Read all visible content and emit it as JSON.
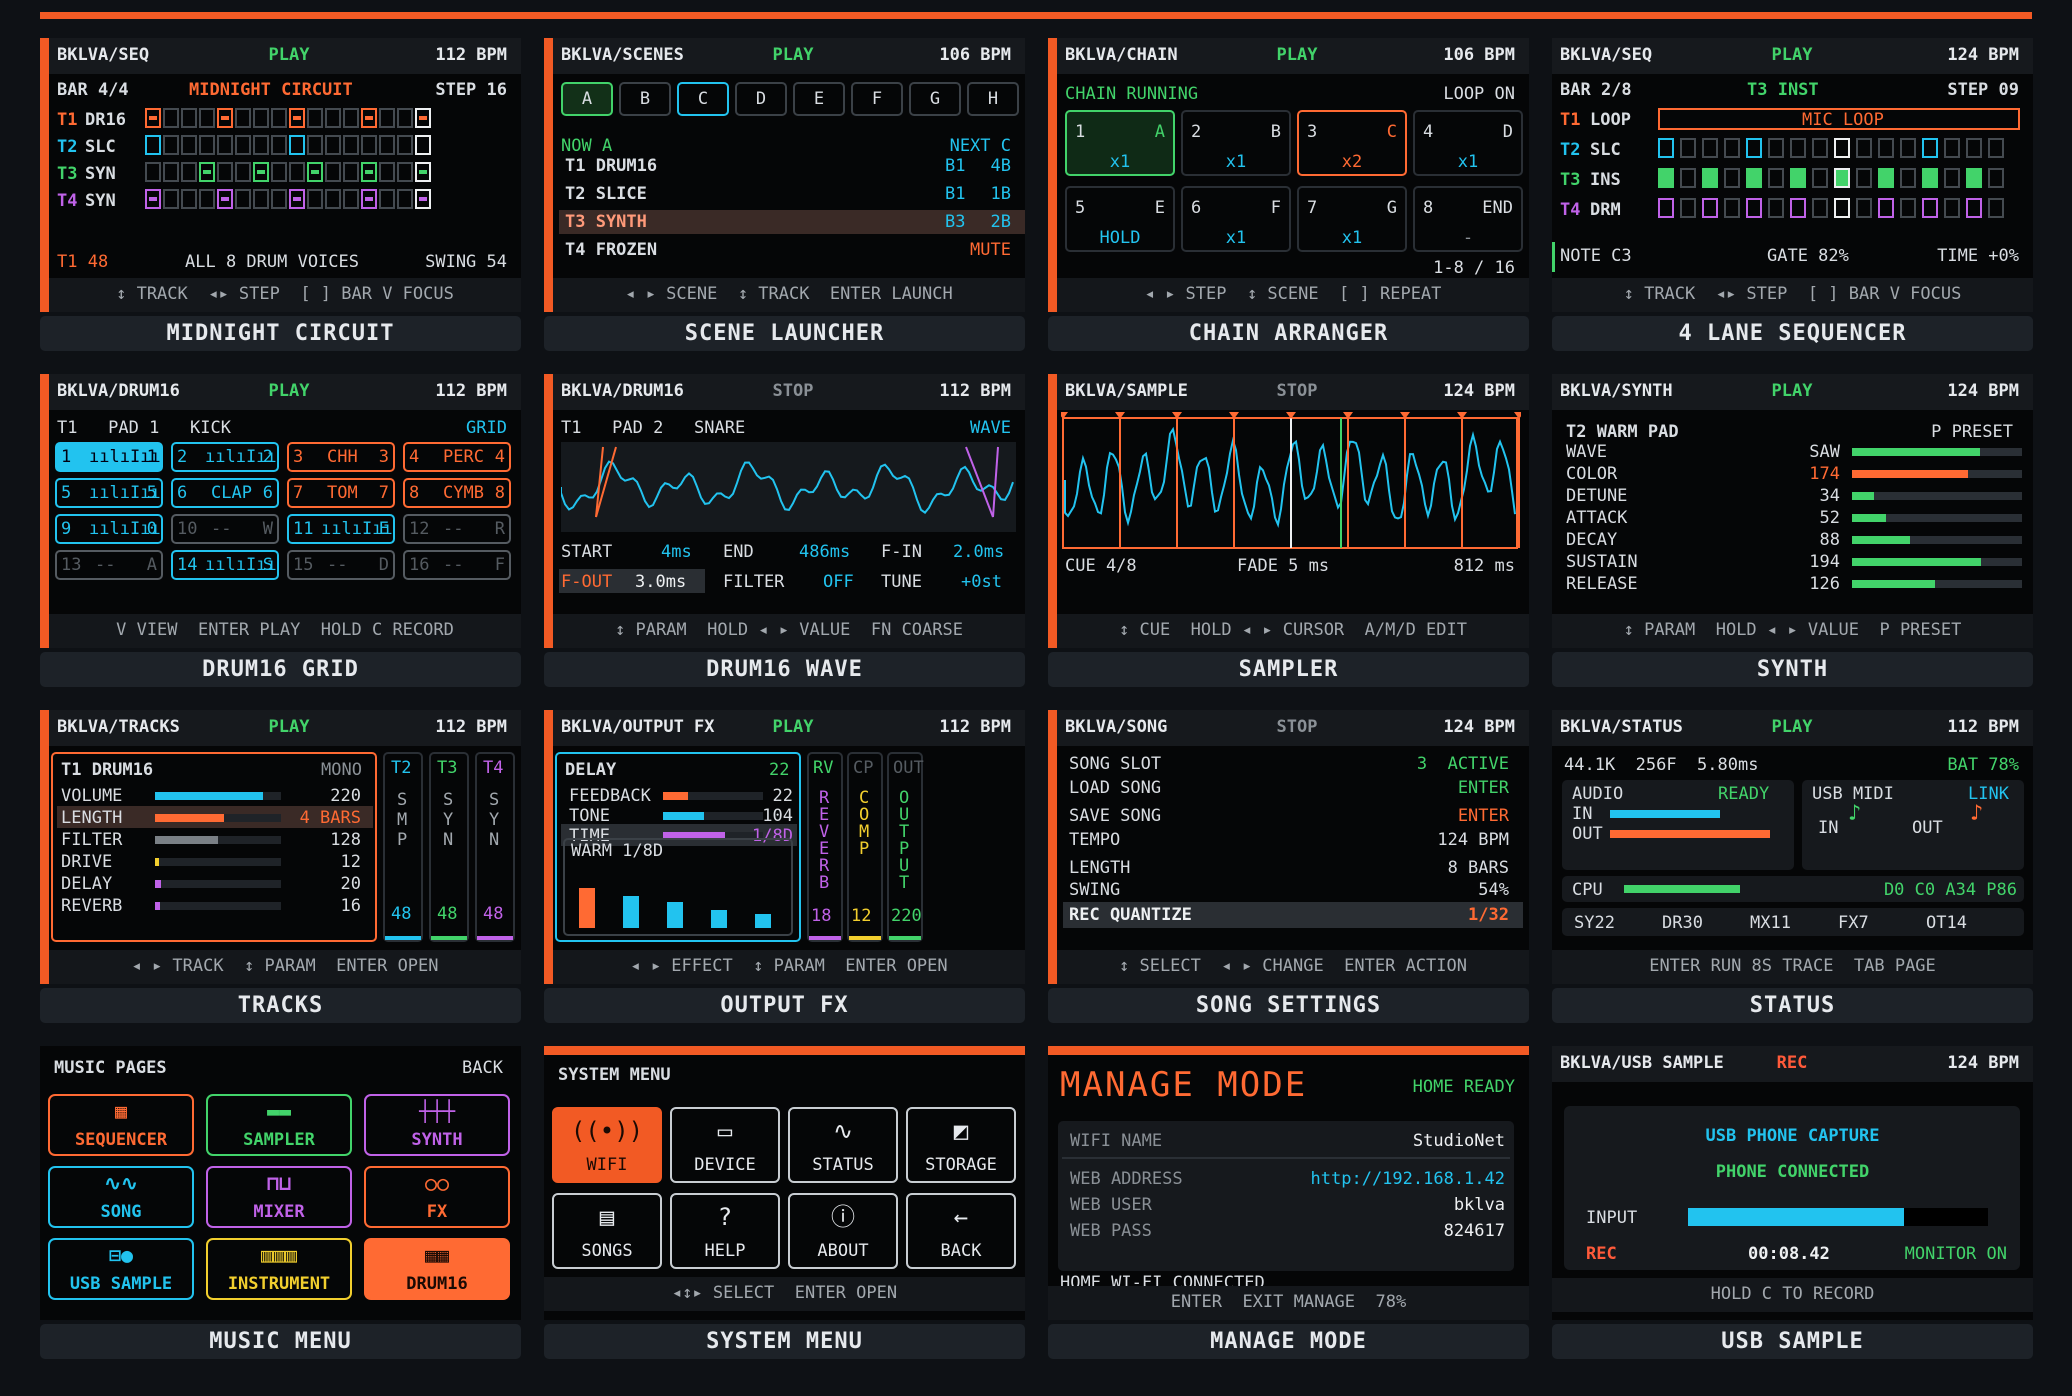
{
  "panels": {
    "p1": {
      "title": "BKLVA/SEQ",
      "state": "PLAY",
      "bpm": "112 BPM",
      "bar": "BAR 4/4",
      "name": "MIDNIGHT CIRCUIT",
      "step": "STEP 16",
      "rows": [
        {
          "num": "T1",
          "lbl": "DR16"
        },
        {
          "num": "T2",
          "lbl": "SLC"
        },
        {
          "num": "T3",
          "lbl": "SYN"
        },
        {
          "num": "T4",
          "lbl": "SYN"
        }
      ],
      "info_l": "T1 48",
      "info_m": "ALL 8 DRUM VOICES",
      "info_r": "SWING 54",
      "foot": "↕ TRACK  ◂▸ STEP  [ ] BAR V FOCUS",
      "caption": "MIDNIGHT CIRCUIT"
    },
    "p2": {
      "title": "BKLVA/SCENES",
      "state": "PLAY",
      "bpm": "106 BPM",
      "scenes": [
        "A",
        "B",
        "C",
        "D",
        "E",
        "F",
        "G",
        "H"
      ],
      "now": "NOW A",
      "next": "NEXT C",
      "rows": [
        {
          "t": "T1 DRUM16",
          "a": "B1",
          "b": "4B"
        },
        {
          "t": "T2 SLICE",
          "a": "B1",
          "b": "1B"
        },
        {
          "t": "T3 SYNTH",
          "a": "B3",
          "b": "2B"
        },
        {
          "t": "T4 FROZEN",
          "a": "",
          "b": "MUTE"
        }
      ],
      "foot": "◂ ▸ SCENE  ↕ TRACK  ENTER LAUNCH",
      "caption": "SCENE LAUNCHER"
    },
    "p3": {
      "title": "BKLVA/CHAIN",
      "state": "PLAY",
      "bpm": "106 BPM",
      "status": "CHAIN RUNNING",
      "loop": "LOOP ON",
      "slots": [
        {
          "n": "1",
          "s": "A",
          "x": "x1"
        },
        {
          "n": "2",
          "s": "B",
          "x": "x1"
        },
        {
          "n": "3",
          "s": "C",
          "x": "x2"
        },
        {
          "n": "4",
          "s": "D",
          "x": "x1"
        },
        {
          "n": "5",
          "s": "E",
          "x": "HOLD"
        },
        {
          "n": "6",
          "s": "F",
          "x": "x1"
        },
        {
          "n": "7",
          "s": "G",
          "x": "x1"
        },
        {
          "n": "8",
          "s": "END",
          "x": "-"
        }
      ],
      "page": "1-8 / 16",
      "foot": "◂ ▸ STEP  ↕ SCENE  [ ] REPEAT",
      "caption": "CHAIN ARRANGER"
    },
    "p4": {
      "title": "BKLVA/SEQ",
      "state": "PLAY",
      "bpm": "124 BPM",
      "bar": "BAR 2/8",
      "inst": "T3 INST",
      "step": "STEP 09",
      "rows": [
        {
          "num": "T1",
          "lbl": "LOOP"
        },
        {
          "num": "T2",
          "lbl": "SLC"
        },
        {
          "num": "T3",
          "lbl": "INS"
        },
        {
          "num": "T4",
          "lbl": "DRM"
        }
      ],
      "mic": "MIC LOOP",
      "note": "NOTE C3",
      "gate": "GATE 82%",
      "time": "TIME +0%",
      "foot": "↕ TRACK  ◂▸ STEP  [ ] BAR V FOCUS",
      "caption": "4 LANE SEQUENCER"
    },
    "p5": {
      "title": "BKLVA/DRUM16",
      "state": "PLAY",
      "bpm": "112 BPM",
      "info": "T1   PAD 1   KICK",
      "mode": "GRID",
      "pads": [
        {
          "n": "1",
          "l": "",
          "e": "1"
        },
        {
          "n": "2",
          "l": "",
          "e": "2"
        },
        {
          "n": "3",
          "l": "CHH",
          "e": "3"
        },
        {
          "n": "4",
          "l": "PERC",
          "e": "4"
        },
        {
          "n": "5",
          "l": "",
          "e": "5"
        },
        {
          "n": "6",
          "l": "CLAP",
          "e": "6"
        },
        {
          "n": "7",
          "l": "TOM",
          "e": "7"
        },
        {
          "n": "8",
          "l": "CYMB",
          "e": "8"
        },
        {
          "n": "9",
          "l": "",
          "e": "0"
        },
        {
          "n": "10",
          "l": "--",
          "e": "W"
        },
        {
          "n": "11",
          "l": "",
          "e": "E"
        },
        {
          "n": "12",
          "l": "--",
          "e": "R"
        },
        {
          "n": "13",
          "l": "--",
          "e": "A"
        },
        {
          "n": "14",
          "l": "",
          "e": "S"
        },
        {
          "n": "15",
          "l": "--",
          "e": "D"
        },
        {
          "n": "16",
          "l": "--",
          "e": "F"
        }
      ],
      "foot": "V VIEW  ENTER PLAY  HOLD C RECORD",
      "caption": "DRUM16 GRID"
    },
    "p6": {
      "title": "BKLVA/DRUM16",
      "state": "STOP",
      "bpm": "112 BPM",
      "info": "T1   PAD 2   SNARE",
      "mode": "WAVE",
      "start_l": "START",
      "start_v": "4ms",
      "end_l": "END",
      "end_v": "486ms",
      "fin_l": "F-IN",
      "fin_v": "2.0ms",
      "fout_l": "F-OUT",
      "fout_v": "3.0ms",
      "filter_l": "FILTER",
      "filter_v": "OFF",
      "tune_l": "TUNE",
      "tune_v": "+0st",
      "foot": "↕ PARAM  HOLD ◂ ▸ VALUE  FN COARSE",
      "caption": "DRUM16 WAVE"
    },
    "p7": {
      "title": "BKLVA/SAMPLE",
      "state": "STOP",
      "bpm": "124 BPM",
      "cue": "CUE 4/8",
      "fade": "FADE 5 ms",
      "len": "812 ms",
      "foot": "↕ CUE  HOLD ◂ ▸ CURSOR  A/M/D EDIT",
      "caption": "SAMPLER"
    },
    "p8": {
      "title": "BKLVA/SYNTH",
      "state": "PLAY",
      "bpm": "124 BPM",
      "patch": "T2 WARM PAD",
      "preset": "P PRESET",
      "params": [
        {
          "l": "WAVE",
          "v": "SAW",
          "f": 0.75
        },
        {
          "l": "COLOR",
          "v": "174",
          "f": 0.68
        },
        {
          "l": "DETUNE",
          "v": "34",
          "f": 0.13
        },
        {
          "l": "ATTACK",
          "v": "52",
          "f": 0.2
        },
        {
          "l": "DECAY",
          "v": "88",
          "f": 0.34
        },
        {
          "l": "SUSTAIN",
          "v": "194",
          "f": 0.76
        },
        {
          "l": "RELEASE",
          "v": "126",
          "f": 0.49
        }
      ],
      "foot": "↕ PARAM  HOLD ◂ ▸ VALUE  P PRESET",
      "caption": "SYNTH"
    },
    "p9": {
      "title": "BKLVA/TRACKS",
      "state": "PLAY",
      "bpm": "112 BPM",
      "track": "T1 DRUM16",
      "mono": "MONO",
      "params": [
        {
          "l": "VOLUME",
          "v": "220",
          "f": 0.86,
          "c": "#22c3ef"
        },
        {
          "l": "LENGTH",
          "v": "4 BARS",
          "f": 0.55,
          "c": "#ff6a33"
        },
        {
          "l": "FILTER",
          "v": "128",
          "f": 0.5,
          "c": "#7a8086"
        },
        {
          "l": "DRIVE",
          "v": "12",
          "f": 0.03,
          "c": "#f2cf2e"
        },
        {
          "l": "DELAY",
          "v": "20",
          "f": 0.05,
          "c": "#c062e8"
        },
        {
          "l": "REVERB",
          "v": "16",
          "f": 0.04,
          "c": "#c062e8"
        }
      ],
      "lanes": [
        {
          "h": "T2",
          "v": "SMP",
          "val": "48",
          "c": "#22c3ef"
        },
        {
          "h": "T3",
          "v": "SYN",
          "val": "48",
          "c": "#42d36a"
        },
        {
          "h": "T4",
          "v": "SYN",
          "val": "48",
          "c": "#c062e8"
        }
      ],
      "foot": "◂ ▸ TRACK  ↕ PARAM  ENTER OPEN",
      "caption": "TRACKS"
    },
    "p10": {
      "title": "BKLVA/OUTPUT FX",
      "state": "PLAY",
      "bpm": "112 BPM",
      "fx": "DELAY",
      "fxv": "22",
      "params": [
        {
          "l": "FEEDBACK",
          "v": "22",
          "f": 0.25,
          "c": "#ff6a33"
        },
        {
          "l": "TONE",
          "v": "104",
          "f": 0.41,
          "c": "#22c3ef"
        },
        {
          "l": "TIME",
          "v": "1/8D",
          "f": 0.62,
          "c": "#c062e8"
        }
      ],
      "warm": "WARM 1/8D",
      "cols": [
        {
          "h": "RV",
          "v": "REVERB",
          "val": "18",
          "c": "#c062e8"
        },
        {
          "h": "CP",
          "v": "COMP",
          "val": "12",
          "c": "#f2cf2e"
        },
        {
          "h": "OUT",
          "v": "OUTPUT",
          "val": "220",
          "c": "#42d36a"
        }
      ],
      "foot": "◂ ▸ EFFECT  ↕ PARAM  ENTER OPEN",
      "caption": "OUTPUT FX"
    },
    "p11": {
      "title": "BKLVA/SONG",
      "state": "STOP",
      "bpm": "124 BPM",
      "rows": [
        {
          "l": "SONG SLOT",
          "v": "3  ACTIVE"
        },
        {
          "l": "LOAD SONG",
          "v": "ENTER"
        },
        {
          "l": "SAVE SONG",
          "v": "ENTER"
        },
        {
          "l": "TEMPO",
          "v": "124 BPM"
        },
        {
          "l": "LENGTH",
          "v": "8 BARS"
        },
        {
          "l": "SWING",
          "v": "54%"
        }
      ],
      "rq_l": "REC QUANTIZE",
      "rq_v": "1/32",
      "foot": "↕ SELECT  ◂ ▸ CHANGE  ENTER ACTION",
      "caption": "SONG SETTINGS"
    },
    "p12": {
      "title": "BKLVA/STATUS",
      "state": "PLAY",
      "bpm": "112 BPM",
      "sys": "44.1K  256F  5.80ms",
      "bat": "BAT 78%",
      "audio": "AUDIO",
      "ready": "READY",
      "in": "IN",
      "out": "OUT",
      "midi": "USB MIDI",
      "link": "LINK",
      "cpu": "CPU",
      "cpu_v": "D0 C0 A34 P86",
      "chips": [
        "SY22",
        "DR30",
        "MX11",
        "FX7",
        "OT14"
      ],
      "foot": "ENTER RUN 8S TRACE  TAB PAGE",
      "caption": "STATUS"
    },
    "p13": {
      "title": "MUSIC PAGES",
      "back": "BACK",
      "items": [
        {
          "l": "SEQUENCER",
          "c": "#ff6a33"
        },
        {
          "l": "SAMPLER",
          "c": "#42d36a"
        },
        {
          "l": "SYNTH",
          "c": "#c062e8"
        },
        {
          "l": "SONG",
          "c": "#22c3ef"
        },
        {
          "l": "MIXER",
          "c": "#c062e8"
        },
        {
          "l": "FX",
          "c": "#ff6a33"
        },
        {
          "l": "USB SAMPLE",
          "c": "#22c3ef"
        },
        {
          "l": "INSTRUMENT",
          "c": "#f2cf2e"
        },
        {
          "l": "DRUM16",
          "c": "#ff6a33"
        }
      ],
      "caption": "MUSIC MENU"
    },
    "p14": {
      "title": "SYSTEM MENU",
      "items": [
        "WIFI",
        "DEVICE",
        "STATUS",
        "STORAGE",
        "SONGS",
        "HELP",
        "ABOUT",
        "BACK"
      ],
      "foot": "◂↕▸ SELECT  ENTER OPEN",
      "caption": "SYSTEM MENU"
    },
    "p15": {
      "title": "MANAGE MODE",
      "ready": "HOME READY",
      "rows": [
        {
          "l": "WIFI NAME",
          "v": "StudioNet"
        },
        {
          "l": "WEB ADDRESS",
          "v": "http://192.168.1.42"
        },
        {
          "l": "WEB USER",
          "v": "bklva"
        },
        {
          "l": "WEB PASS",
          "v": "824617"
        }
      ],
      "wifi": "HOME WI-FI CONNECTED",
      "foot": "ENTER  EXIT MANAGE  78%",
      "caption": "MANAGE MODE"
    },
    "p16": {
      "title": "BKLVA/USB SAMPLE",
      "state": "REC",
      "bpm": "124 BPM",
      "l1": "USB PHONE CAPTURE",
      "l2": "PHONE CONNECTED",
      "input": "INPUT",
      "rec": "REC",
      "time": "00:08.42",
      "mon": "MONITOR ON",
      "level": 0.72,
      "foot": "HOLD C TO RECORD",
      "caption": "USB SAMPLE"
    }
  }
}
